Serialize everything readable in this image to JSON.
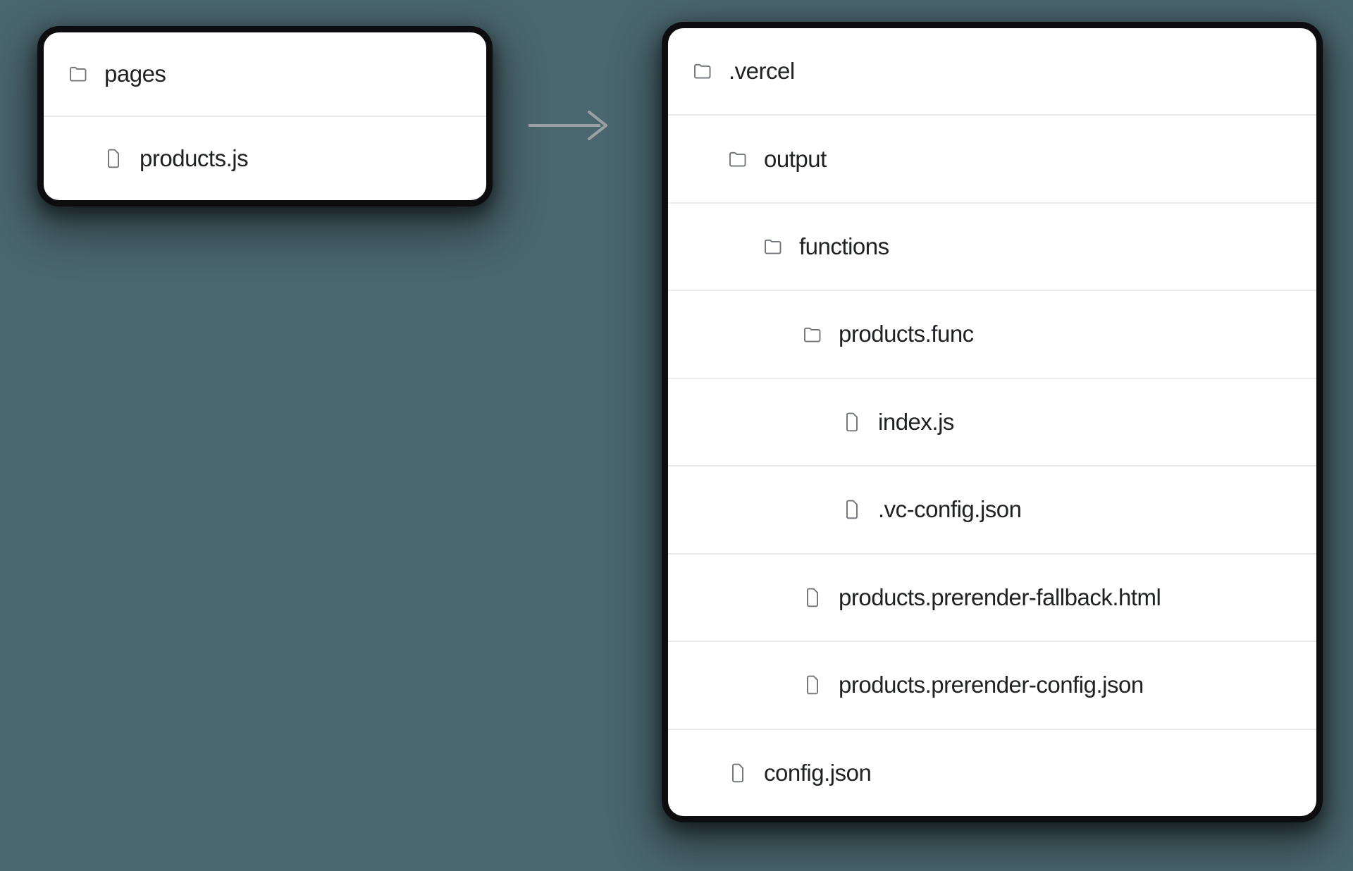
{
  "background_color": "#4a666e",
  "panel_background": "#ffffff",
  "panel_border_color": "#0d0d0f",
  "row_divider_color": "#e9eaeb",
  "text_color": "#1f2124",
  "icon_color": "#6f7276",
  "arrow": {
    "name": "transform-arrow",
    "direction": "right",
    "color": "#9aa0a3"
  },
  "source_panel": {
    "title": "pages",
    "rows": [
      {
        "label": "pages",
        "icon": "folder-icon",
        "type": "folder",
        "indent": 0
      },
      {
        "label": "products.js",
        "icon": "file-icon",
        "type": "file",
        "indent": 1
      }
    ]
  },
  "output_panel": {
    "title": ".vercel",
    "rows": [
      {
        "label": ".vercel",
        "icon": "folder-icon",
        "type": "folder",
        "indent": 0
      },
      {
        "label": "output",
        "icon": "folder-icon",
        "type": "folder",
        "indent": 1
      },
      {
        "label": "functions",
        "icon": "folder-icon",
        "type": "folder",
        "indent": 2
      },
      {
        "label": "products.func",
        "icon": "folder-icon",
        "type": "folder",
        "indent": 3
      },
      {
        "label": "index.js",
        "icon": "file-icon",
        "type": "file",
        "indent": 4
      },
      {
        "label": ".vc-config.json",
        "icon": "file-icon",
        "type": "file",
        "indent": 4
      },
      {
        "label": "products.prerender-fallback.html",
        "icon": "file-icon",
        "type": "file",
        "indent": 3
      },
      {
        "label": "products.prerender-config.json",
        "icon": "file-icon",
        "type": "file",
        "indent": 3
      },
      {
        "label": "config.json",
        "icon": "file-icon",
        "type": "file",
        "indent": 1
      }
    ]
  }
}
